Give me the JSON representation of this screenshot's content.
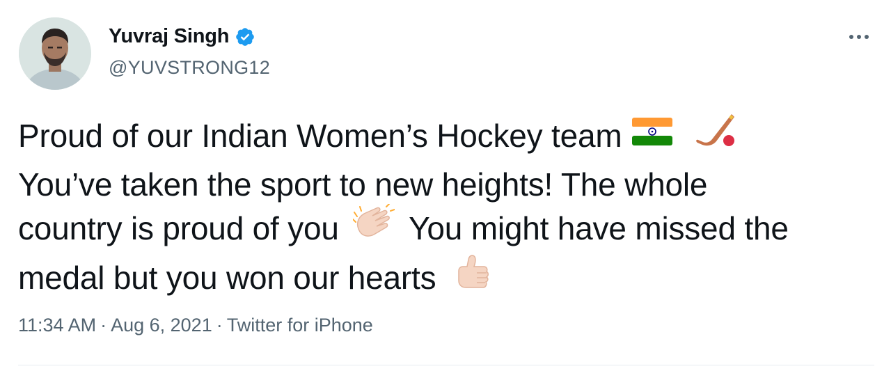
{
  "author": {
    "name": "Yuvraj Singh",
    "handle": "@YUVSTRONG12",
    "verified": true,
    "avatar_icon": "profile-photo"
  },
  "more_icon": "more-horizontal-icon",
  "tweet": {
    "line1": "Proud of our Indian Women’s Hockey team",
    "line2": "You’ve taken the sport to new heights! The whole",
    "line3_a": "country is proud of you",
    "line3_b": "You might have missed the",
    "line4": "medal but you won our hearts",
    "emojis": [
      "india-flag-icon",
      "field-hockey-icon",
      "clapping-hands-icon",
      "thumbs-up-icon"
    ]
  },
  "meta": {
    "time": "11:34 AM",
    "date": "Aug 6, 2021",
    "separator": "·",
    "source": "Twitter for iPhone"
  },
  "colors": {
    "text": "#0f1419",
    "secondary": "#536471",
    "verified_blue": "#1d9bf0",
    "divider": "#e6ecf0"
  }
}
